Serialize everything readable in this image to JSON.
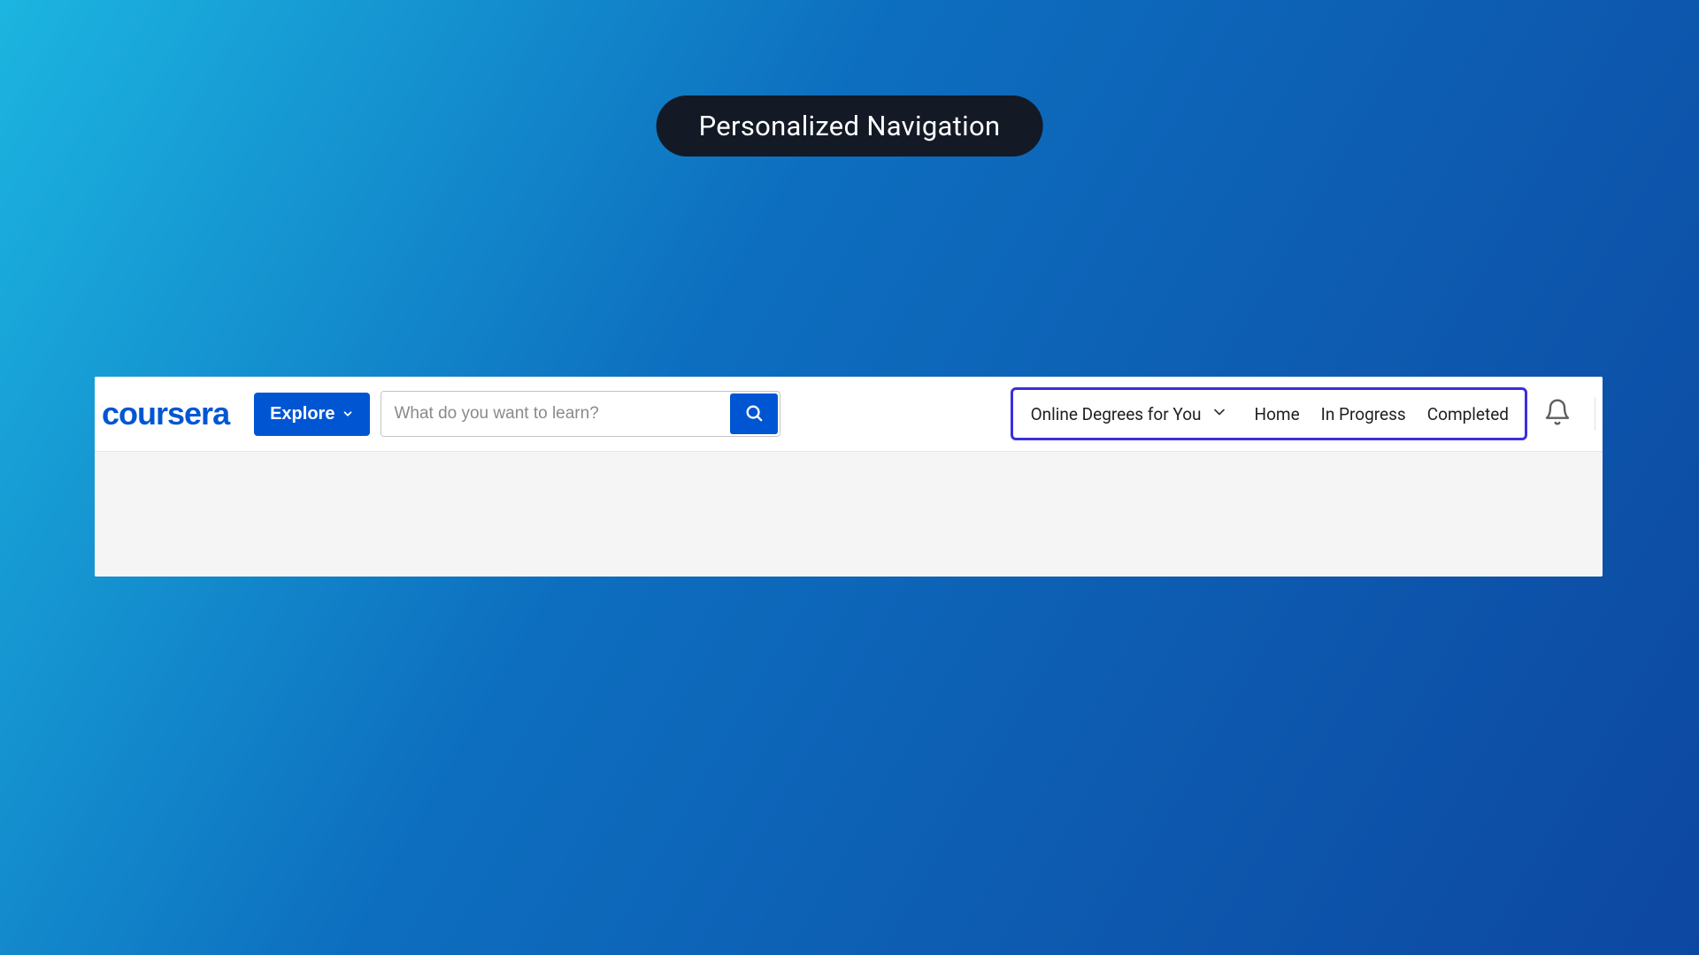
{
  "title_pill": "Personalized Navigation",
  "logo_text": "coursera",
  "explore_label": "Explore",
  "search": {
    "placeholder": "What do you want to learn?"
  },
  "nav": {
    "degrees_label": "Online Degrees for You",
    "links": {
      "home": "Home",
      "in_progress": "In Progress",
      "completed": "Completed"
    }
  },
  "icons": {
    "chevron_down": "chevron-down",
    "chevron_down_thin": "chevron-down",
    "search": "search",
    "bell": "bell"
  },
  "colors": {
    "brand_blue": "#0056D2",
    "highlight_border": "#3b2fdb",
    "pill_bg": "#131a26"
  }
}
